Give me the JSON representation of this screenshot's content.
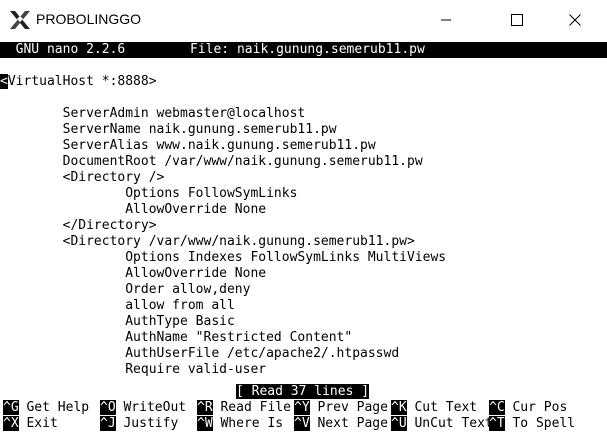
{
  "window": {
    "title": "PROBOLINGGO"
  },
  "nano": {
    "version": "  GNU nano 2.2.6",
    "file_label": "File: naik.gunung.semerub11.pw",
    "status": "[ Read 37 lines ]"
  },
  "content": {
    "line0_cursor": "<",
    "line0_rest": "VirtualHost *:8888>",
    "lines": [
      "",
      "        ServerAdmin webmaster@localhost",
      "        ServerName naik.gunung.semerub11.pw",
      "        ServerAlias www.naik.gunung.semerub11.pw",
      "        DocumentRoot /var/www/naik.gunung.semerub11.pw",
      "        <Directory />",
      "                Options FollowSymLinks",
      "                AllowOverride None",
      "        </Directory>",
      "        <Directory /var/www/naik.gunung.semerub11.pw>",
      "                Options Indexes FollowSymLinks MultiViews",
      "                AllowOverride None",
      "                Order allow,deny",
      "                allow from all",
      "                AuthType Basic",
      "                AuthName \"Restricted Content\"",
      "                AuthUserFile /etc/apache2/.htpasswd",
      "                Require valid-user"
    ]
  },
  "shortcuts": {
    "row1": [
      {
        "key": "^G",
        "label": " Get Help"
      },
      {
        "key": "^O",
        "label": " WriteOut"
      },
      {
        "key": "^R",
        "label": " Read File"
      },
      {
        "key": "^Y",
        "label": " Prev Page"
      },
      {
        "key": "^K",
        "label": " Cut Text"
      },
      {
        "key": "^C",
        "label": " Cur Pos"
      }
    ],
    "row2": [
      {
        "key": "^X",
        "label": " Exit"
      },
      {
        "key": "^J",
        "label": " Justify"
      },
      {
        "key": "^W",
        "label": " Where Is"
      },
      {
        "key": "^V",
        "label": " Next Page"
      },
      {
        "key": "^U",
        "label": " UnCut Text"
      },
      {
        "key": "^T",
        "label": " To Spell"
      }
    ]
  }
}
